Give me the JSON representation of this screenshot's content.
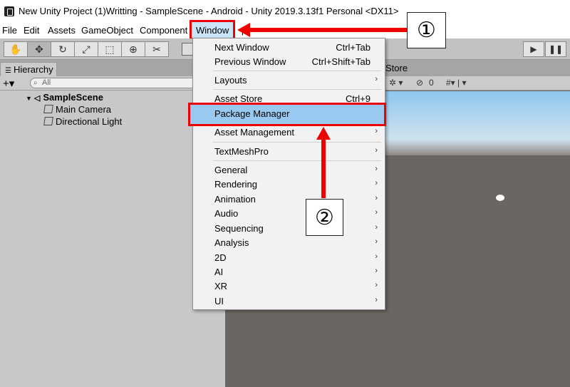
{
  "window": {
    "title": "New Unity Project (1)Writting - SampleScene - Android - Unity 2019.3.13f1 Personal <DX11>"
  },
  "menubar": {
    "items": [
      "File",
      "Edit",
      "Assets",
      "GameObject",
      "Component"
    ],
    "window_label": "Window",
    "help_partial": "p"
  },
  "toolbar": {
    "tools": [
      "hand-icon",
      "move-icon",
      "rotate-icon",
      "scale-icon",
      "rect-icon",
      "transform-icon",
      "custom-tool-icon"
    ],
    "play_icon": "▶",
    "pause_icon": "❚❚"
  },
  "hierarchy": {
    "tab_label": "Hierarchy",
    "search_placeholder": "All",
    "add_label": "+▾",
    "scene": "SampleScene",
    "objects": [
      "Main Camera",
      "Directional Light"
    ]
  },
  "scene_view": {
    "tab_label": "Store",
    "gizmo_count": "0"
  },
  "window_menu": {
    "items": [
      {
        "label": "Next Window",
        "shortcut": "Ctrl+Tab"
      },
      {
        "label": "Previous Window",
        "shortcut": "Ctrl+Shift+Tab"
      },
      {
        "label": "Layouts",
        "submenu": true
      },
      {
        "label": "Asset Store",
        "shortcut": "Ctrl+9"
      },
      {
        "label": "Package Manager"
      },
      {
        "label": "Asset Management",
        "submenu": true
      },
      {
        "label": "TextMeshPro",
        "submenu": true
      },
      {
        "label": "General",
        "submenu": true
      },
      {
        "label": "Rendering",
        "submenu": true
      },
      {
        "label": "Animation",
        "submenu": true
      },
      {
        "label": "Audio",
        "submenu": true
      },
      {
        "label": "Sequencing",
        "submenu": true
      },
      {
        "label": "Analysis",
        "submenu": true
      },
      {
        "label": "2D",
        "submenu": true
      },
      {
        "label": "AI",
        "submenu": true
      },
      {
        "label": "XR",
        "submenu": true
      },
      {
        "label": "UI",
        "submenu": true
      }
    ]
  },
  "annotations": {
    "step1": "①",
    "step2": "②",
    "highlight_color": "#e00000"
  }
}
